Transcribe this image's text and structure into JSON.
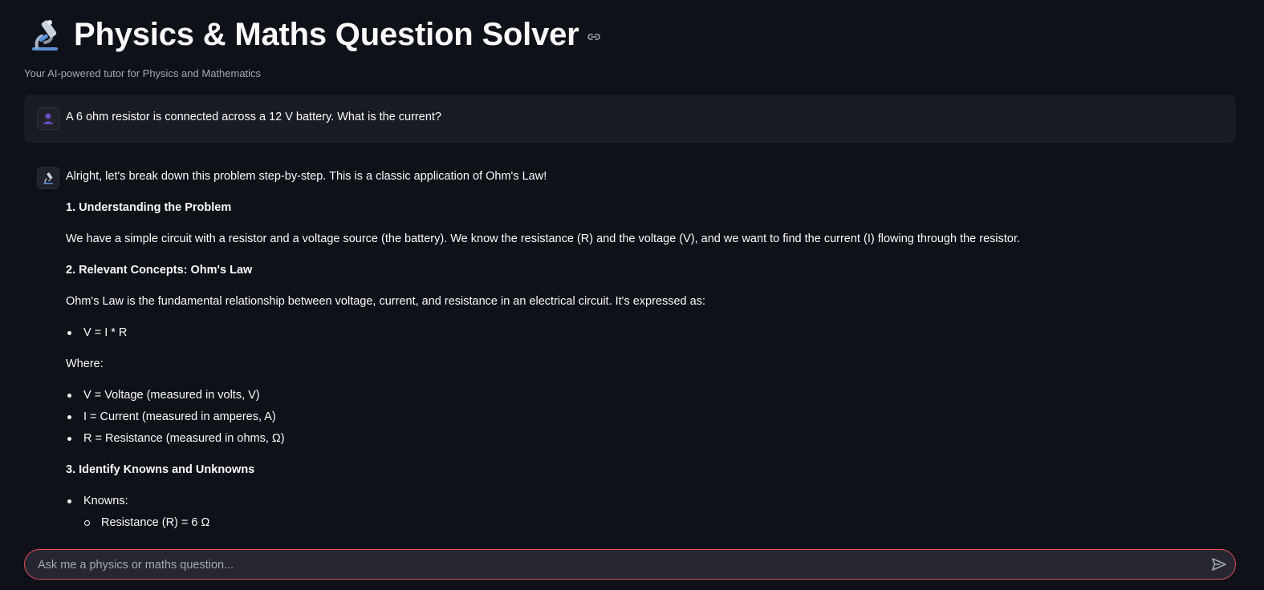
{
  "header": {
    "title": "Physics & Maths Question Solver",
    "title_icon": "microscope-icon",
    "anchor_icon": "link-icon",
    "subtitle": "Your AI-powered tutor for Physics and Mathematics"
  },
  "user_message": {
    "avatar_icon": "user-avatar-icon",
    "text": "A 6 ohm resistor is connected across a 12 V battery. What is the current?"
  },
  "assistant_message": {
    "avatar_icon": "microscope-icon",
    "intro": "Alright, let's break down this problem step-by-step. This is a classic application of Ohm's Law!",
    "section1_heading": "1. Understanding the Problem",
    "section1_text": "We have a simple circuit with a resistor and a voltage source (the battery). We know the resistance (R) and the voltage (V), and we want to find the current (I) flowing through the resistor.",
    "section2_heading": "2. Relevant Concepts: Ohm's Law",
    "section2_text": "Ohm's Law is the fundamental relationship between voltage, current, and resistance in an electrical circuit. It's expressed as:",
    "formula": "V = I * R",
    "where_label": "Where:",
    "definitions": [
      "V = Voltage (measured in volts, V)",
      "I = Current (measured in amperes, A)",
      "R = Resistance (measured in ohms, Ω)"
    ],
    "section3_heading": "3. Identify Knowns and Unknowns",
    "knowns_label": "Knowns:",
    "knowns": [
      "Resistance (R) = 6 Ω"
    ]
  },
  "chat_input": {
    "placeholder": "Ask me a physics or maths question...",
    "send_icon": "send-icon"
  },
  "colors": {
    "background": "#0e1117",
    "user_bubble": "#1a1c24",
    "input_border": "#e0505a",
    "input_background": "#262730"
  }
}
